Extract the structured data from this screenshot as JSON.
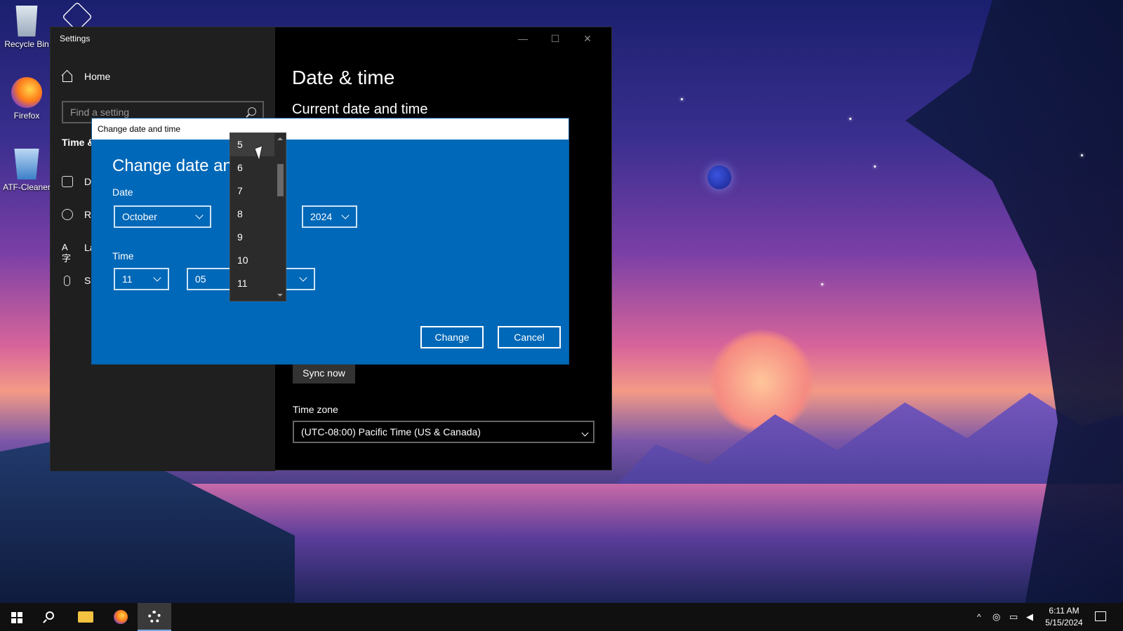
{
  "desktop": {
    "icons": [
      {
        "label": "Recycle Bin",
        "icon": "recycle-bin-icon"
      },
      {
        "label": "Firefox",
        "icon": "firefox-icon"
      },
      {
        "label": "ATF-Cleaner",
        "icon": "atf-cleaner-icon"
      },
      {
        "label": "",
        "icon": "3d-box-icon"
      }
    ]
  },
  "settings": {
    "window_title": "Settings",
    "controls": {
      "minimize": "—",
      "maximize": "☐",
      "close": "✕"
    },
    "home_label": "Home",
    "search_placeholder": "Find a setting",
    "section_label": "Time &",
    "nav_items": [
      {
        "label": "Da",
        "icon": "calendar-icon"
      },
      {
        "label": "Re",
        "icon": "globe-icon"
      },
      {
        "label": "La",
        "icon": "language-icon"
      },
      {
        "label": "Sp",
        "icon": "microphone-icon"
      }
    ],
    "page_title": "Date & time",
    "sub_title": "Current date and time",
    "sync_now_label": "Sync now",
    "time_zone_label": "Time zone",
    "time_zone_value": "(UTC-08:00) Pacific Time (US & Canada)"
  },
  "dialog": {
    "window_title": "Change date and time",
    "heading": "Change date and",
    "date_label": "Date",
    "month_value": "October",
    "year_value": "2024",
    "time_label": "Time",
    "hour_value": "11",
    "minute_value": "05",
    "change_label": "Change",
    "cancel_label": "Cancel"
  },
  "day_dropdown": {
    "items": [
      "5",
      "6",
      "7",
      "8",
      "9",
      "10",
      "11"
    ],
    "highlighted": "5"
  },
  "taskbar": {
    "apps": [
      "start-icon",
      "search-icon",
      "file-explorer-icon",
      "firefox-icon",
      "settings-icon"
    ],
    "active_app": "settings-icon",
    "clock_time": "6:11 AM",
    "clock_date": "5/15/2024",
    "tray_chevron": "^"
  },
  "colors": {
    "dialog_blue": "#0068b8",
    "settings_bg": "#000000",
    "sidebar_bg": "#1f1f1f",
    "taskbar_bg": "#101010"
  }
}
